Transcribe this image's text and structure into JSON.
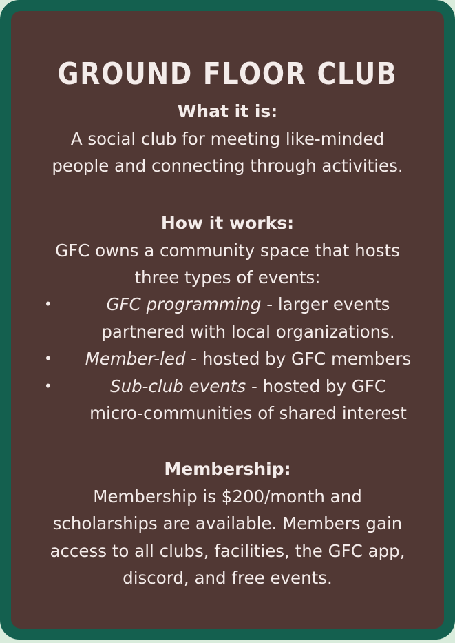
{
  "title": "GROUND FLOOR CLUB",
  "what": {
    "heading": "What it is:",
    "lines": [
      "A social club for meeting like-minded",
      "people and connecting through activities."
    ]
  },
  "how": {
    "heading": "How it works:",
    "lines": [
      "GFC owns a community space that hosts",
      "three types of events:"
    ],
    "bullets": [
      {
        "term": "GFC programming",
        "rest": " - larger events",
        "continuation": "partnered with local organizations."
      },
      {
        "term": "Member-led",
        "rest": " - hosted by GFC members",
        "continuation": ""
      },
      {
        "term": "Sub-club events",
        "rest": " - hosted by GFC",
        "continuation": "micro-communities of shared interest"
      }
    ]
  },
  "membership": {
    "heading": "Membership:",
    "lines": [
      "Membership is $200/month and",
      "scholarships are available. Members gain",
      "access to all clubs, facilities, the GFC app,",
      "discord, and free events."
    ]
  },
  "colors": {
    "outer_border": "#14604f",
    "card_background": "#513834",
    "text": "#f4ecea"
  }
}
